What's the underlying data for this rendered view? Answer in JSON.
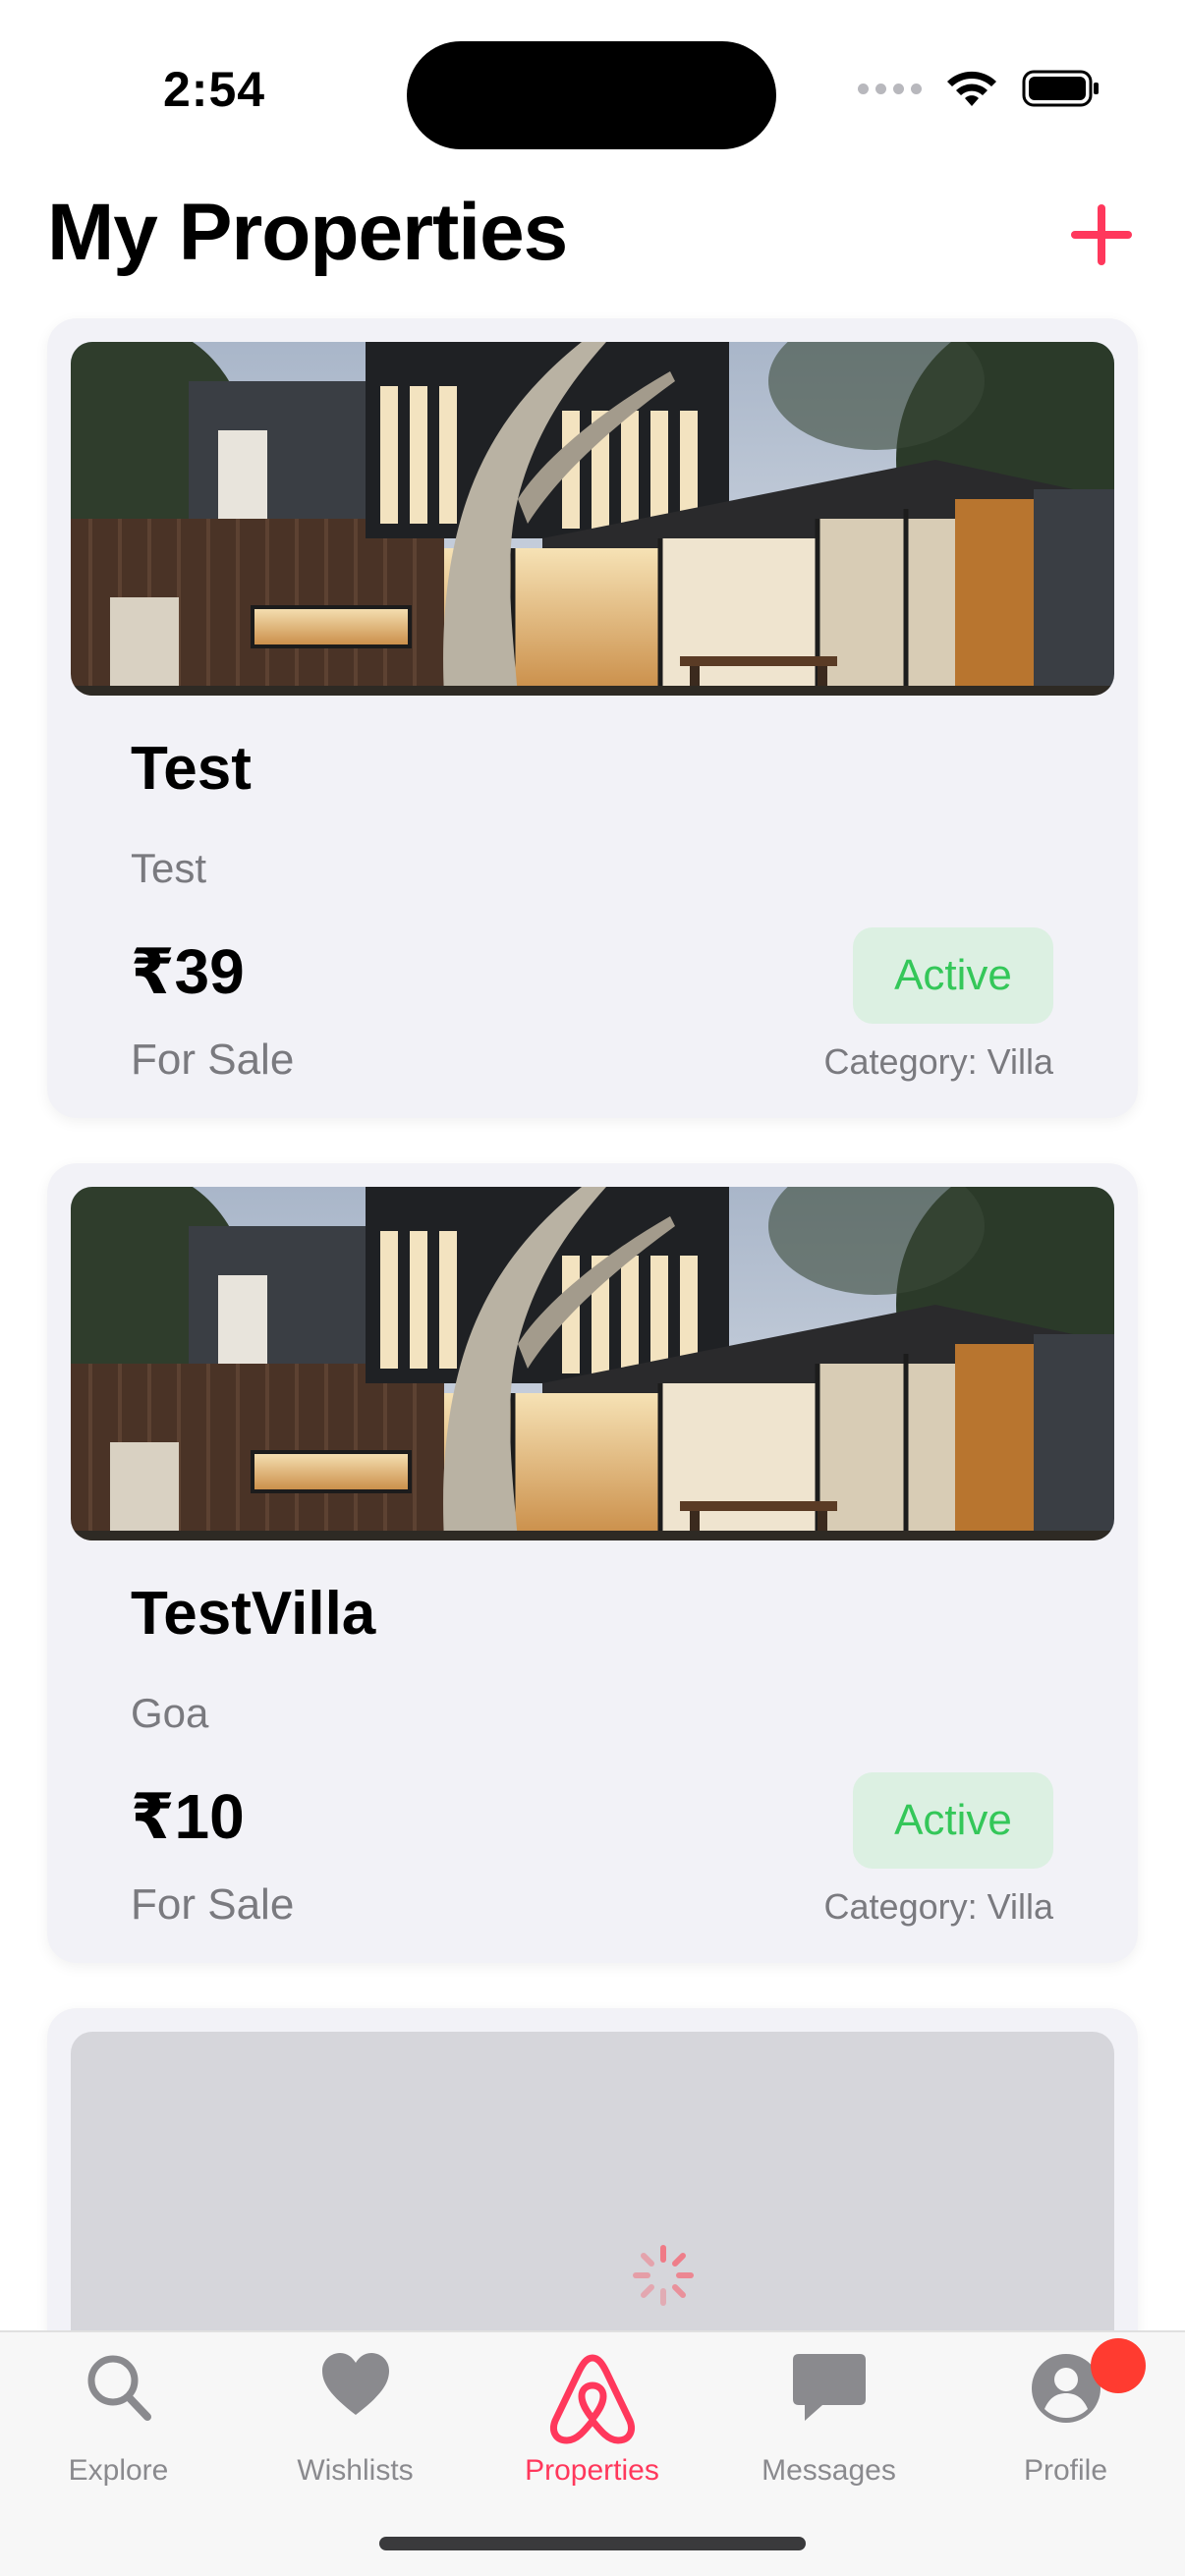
{
  "status_bar": {
    "time": "2:54"
  },
  "header": {
    "title": "My Properties",
    "add_icon": "plus-icon"
  },
  "properties": [
    {
      "title": "Test",
      "location": "Test",
      "price": "₹39",
      "listing_type": "For Sale",
      "status": "Active",
      "category": "Category: Villa"
    },
    {
      "title": "TestVilla",
      "location": "Goa",
      "price": "₹10",
      "listing_type": "For Sale",
      "status": "Active",
      "category": "Category: Villa"
    }
  ],
  "tabs": [
    {
      "label": "Explore",
      "icon": "search-icon"
    },
    {
      "label": "Wishlists",
      "icon": "heart-icon"
    },
    {
      "label": "Properties",
      "icon": "airbnb-logo-icon",
      "active": true
    },
    {
      "label": "Messages",
      "icon": "chat-bubble-icon"
    },
    {
      "label": "Profile",
      "icon": "person-icon",
      "badge": true
    }
  ],
  "colors": {
    "accent": "#ff385c",
    "status_active_text": "#34c759",
    "status_active_bg": "#dcf0e2",
    "card_bg": "#f2f2f7"
  }
}
